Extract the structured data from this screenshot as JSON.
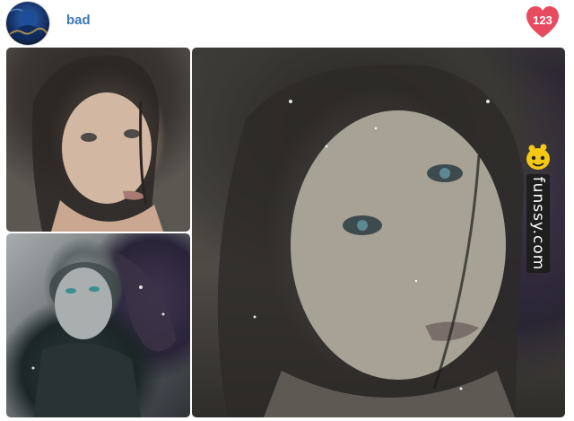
{
  "post": {
    "username": "bad",
    "like_count": "123",
    "avatar_icon": "avatar-icon",
    "like_icon": "heart-icon",
    "like_color": "#e84a5f",
    "link_color": "#3b78b9"
  },
  "images": [
    {
      "role": "original-photo",
      "icon": "photo-portrait"
    },
    {
      "role": "style-image",
      "icon": "photo-portrait-artistic"
    },
    {
      "role": "result-image",
      "icon": "photo-portrait-stylized"
    }
  ],
  "watermark": {
    "brand": "funssy.com",
    "icon": "mascot-icon"
  }
}
